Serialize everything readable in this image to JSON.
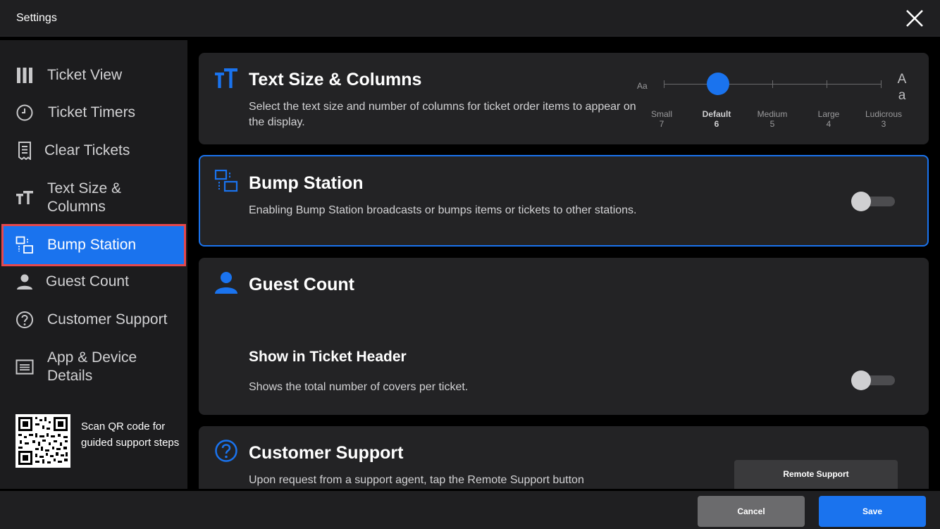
{
  "window": {
    "title": "Settings"
  },
  "colors": {
    "accent": "#1a73ee",
    "highlight_outline": "#e5484d",
    "card_bg": "#232325",
    "sidebar_bg": "#1c1c1e"
  },
  "sidebar": {
    "items": [
      {
        "label": "Ticket View",
        "icon": "columns-icon"
      },
      {
        "label": "Ticket Timers",
        "icon": "clock-icon"
      },
      {
        "label": "Clear Tickets",
        "icon": "receipt-icon"
      },
      {
        "label": "Text Size & Columns",
        "icon": "text-size-icon"
      },
      {
        "label": "Bump Station",
        "icon": "bump-station-icon",
        "active": true
      },
      {
        "label": "Guest Count",
        "icon": "person-icon"
      },
      {
        "label": "Customer Support",
        "icon": "help-circle-icon"
      },
      {
        "label": "App & Device Details",
        "icon": "device-details-icon"
      }
    ],
    "qr_text": "Scan QR code for guided support steps"
  },
  "sections": {
    "text_size": {
      "title": "Text Size & Columns",
      "description": "Select the text size and number of columns for ticket order items to appear on the display.",
      "slider": {
        "small_glyph": "Aa",
        "big_glyph_top": "A",
        "big_glyph_bottom": "a",
        "selected_index": 1,
        "stops": [
          {
            "label": "Small",
            "columns": "7"
          },
          {
            "label": "Default",
            "columns": "6"
          },
          {
            "label": "Medium",
            "columns": "5"
          },
          {
            "label": "Large",
            "columns": "4"
          },
          {
            "label": "Ludicrous",
            "columns": "3"
          }
        ]
      }
    },
    "bump_station": {
      "title": "Bump Station",
      "description": "Enabling Bump Station broadcasts or bumps items or tickets to other stations.",
      "enabled": false
    },
    "guest_count": {
      "title": "Guest Count",
      "show_in_header": {
        "title": "Show in Ticket Header",
        "description": "Shows the total number of covers per ticket.",
        "enabled": false
      }
    },
    "customer_support": {
      "title": "Customer Support",
      "description": "Upon request from a support agent, tap the Remote Support button",
      "button_label": "Remote Support"
    }
  },
  "footer": {
    "cancel_label": "Cancel",
    "save_label": "Save"
  }
}
